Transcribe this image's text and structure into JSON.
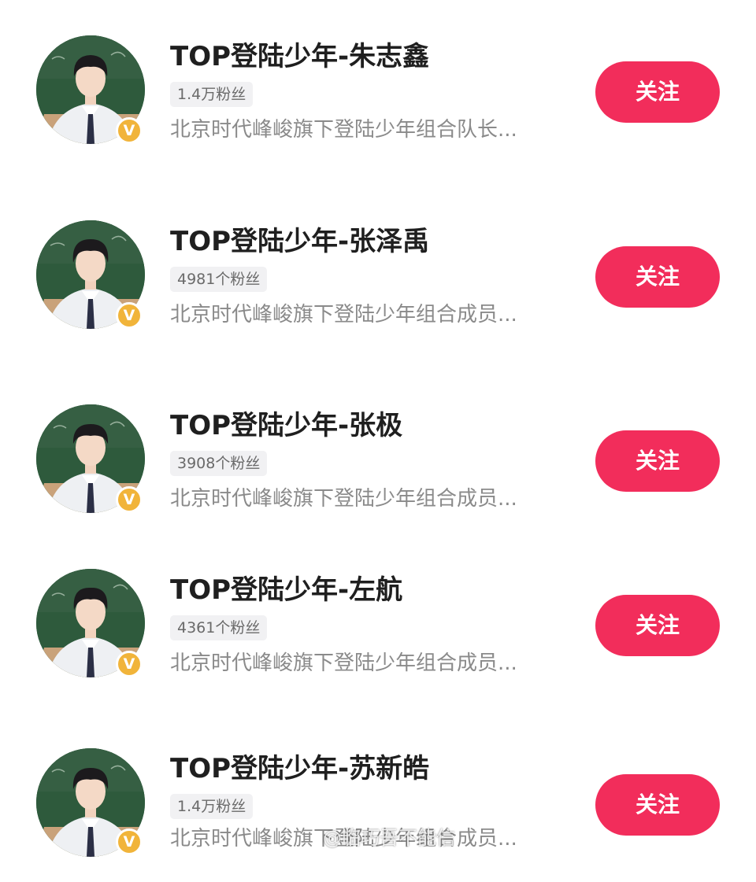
{
  "accounts": [
    {
      "name": "TOP登陆少年-朱志鑫",
      "fans": "1.4万粉丝",
      "desc": "北京时代峰峻旗下登陆少年组合队长...",
      "follow_label": "关注"
    },
    {
      "name": "TOP登陆少年-张泽禹",
      "fans": "4981个粉丝",
      "desc": "北京时代峰峻旗下登陆少年组合成员...",
      "follow_label": "关注"
    },
    {
      "name": "TOP登陆少年-张极",
      "fans": "3908个粉丝",
      "desc": "北京时代峰峻旗下登陆少年组合成员...",
      "follow_label": "关注"
    },
    {
      "name": "TOP登陆少年-左航",
      "fans": "4361个粉丝",
      "desc": "北京时代峰峻旗下登陆少年组合成员...",
      "follow_label": "关注"
    },
    {
      "name": "TOP登陆少年-苏新皓",
      "fans": "1.4万粉丝",
      "desc": "北京时代峰峻旗下登陆少年组合成员...",
      "follow_label": "关注"
    }
  ],
  "verified_mark": "V",
  "watermark": "@临巧吾不能信",
  "colors": {
    "follow_button": "#f22d5b",
    "verified_badge": "#f1b43a",
    "fans_tag_bg": "#f1f1f3"
  },
  "icons": {
    "avatar": "user-avatar-photo",
    "verified": "verified-badge-icon"
  }
}
